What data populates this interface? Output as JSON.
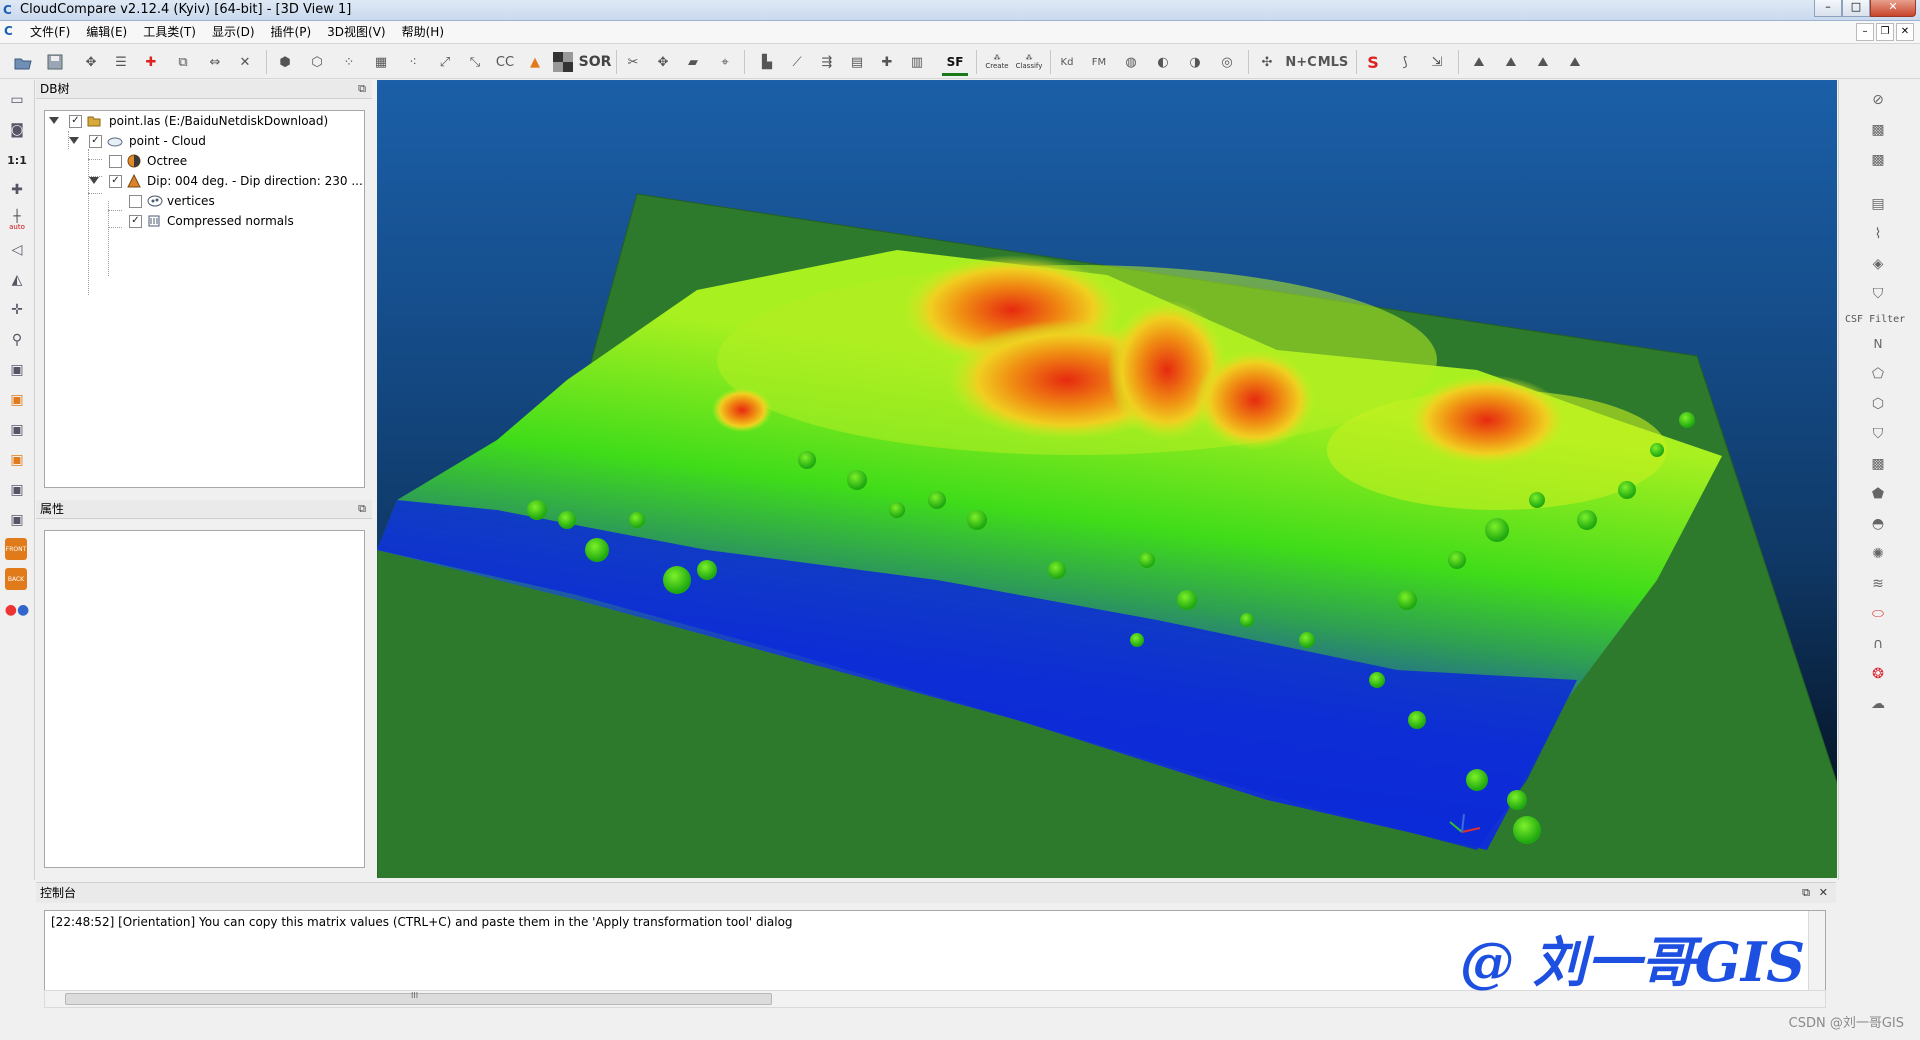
{
  "window": {
    "title": "CloudCompare v2.12.4 (Kyiv) [64-bit] - [3D View 1]",
    "minimize": "–",
    "maximize": "□",
    "close": "✕"
  },
  "menubar": {
    "items": [
      "文件(F)",
      "编辑(E)",
      "工具类(T)",
      "显示(D)",
      "插件(P)",
      "3D视图(V)",
      "帮助(H)"
    ]
  },
  "toolbar": {
    "sor_label": "SOR",
    "sf_label": "SF",
    "nc_label": "N+C",
    "mls_label": "MLS",
    "kd_label": "Kd",
    "fm_label": "FM",
    "canupo_create": "Create",
    "canupo_classify": "Classify"
  },
  "left_strip": {
    "scale_label": "1:1",
    "auto_label": "auto",
    "front_label": "FRONT",
    "back_label": "BACK"
  },
  "db_tree": {
    "title": "DB树",
    "items": [
      {
        "label": "point.las (E:/BaiduNetdiskDownload)",
        "checked": true,
        "icon": "folder-icon"
      },
      {
        "label": "point - Cloud",
        "checked": true,
        "icon": "cloud-icon"
      },
      {
        "label": "Octree",
        "checked": false,
        "icon": "octree-icon"
      },
      {
        "label": "Dip: 004 deg. - Dip direction: 230 ...",
        "checked": true,
        "icon": "facet-icon"
      },
      {
        "label": "vertices",
        "checked": false,
        "icon": "vertices-icon"
      },
      {
        "label": "Compressed normals",
        "checked": true,
        "icon": "normals-icon"
      }
    ]
  },
  "properties": {
    "title": "属性"
  },
  "right_strip": {
    "csf_label": "CSF Filter",
    "north_label": "N"
  },
  "console": {
    "title": "控制台",
    "lines": [
      "[22:48:52] [Orientation] You can copy this matrix values (CTRL+C) and paste them in the 'Apply transformation tool' dialog"
    ],
    "scroll_thumb_label": "III"
  },
  "watermark": "@ 刘一哥GIS",
  "csdn_mark": "CSDN @刘一哥GIS",
  "colors": {
    "view_bg_top": "#1b5fa8",
    "view_bg_bottom": "#020a14",
    "plane": "#2e7a2c",
    "elevation_low": "#0a1fe0",
    "elevation_mid": "#3fdc1a",
    "elevation_high": "#e62a10"
  }
}
